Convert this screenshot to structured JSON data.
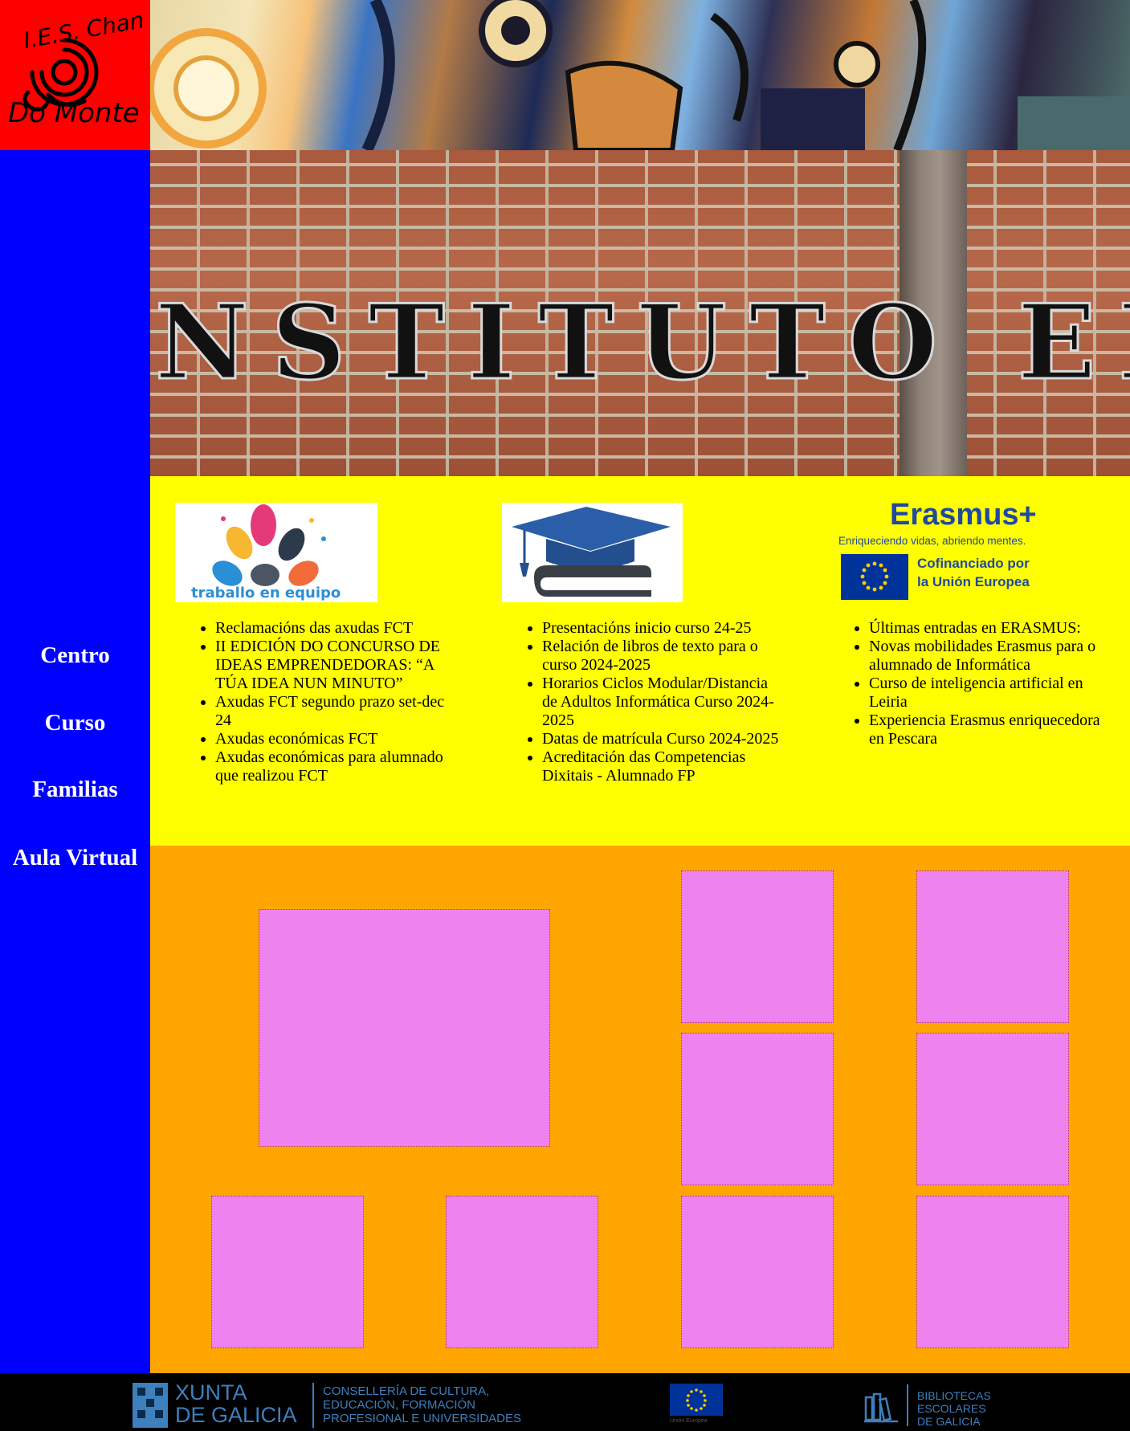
{
  "logo": {
    "line1": "I.E.S. Chan",
    "line2": "Do Monte"
  },
  "nav": [
    {
      "label": "Centro"
    },
    {
      "label": "Curso"
    },
    {
      "label": "Familias"
    },
    {
      "label": "Aula Virtual"
    }
  ],
  "hero": {
    "sign_text": "NSTITUTO",
    "sign_text_2": "EN"
  },
  "columns": [
    {
      "image_caption": "traballo en equipo",
      "items": [
        "Reclamacións das axudas FCT",
        "II EDICIÓN DO CONCURSO DE IDEAS EMPRENDEDORAS: “A TÚA IDEA NUN MINUTO”",
        "Axudas FCT segundo prazo set-dec 24",
        "Axudas económicas FCT",
        "Axudas económicas para alumnado que realizou FCT"
      ]
    },
    {
      "items": [
        "Presentacións inicio curso 24-25",
        "Relación de libros de texto para o curso 2024-2025",
        "Horarios Ciclos Modular/Distancia de Adultos Informática Curso 2024-2025",
        "Datas de matrícula Curso 2024-2025",
        "Acreditación das Competencias Dixitais - Alumnado FP"
      ]
    },
    {
      "erasmus_title": "Erasmus+",
      "erasmus_tagline": "Enriqueciendo vidas, abriendo mentes.",
      "erasmus_cofin_1": "Cofinanciado por",
      "erasmus_cofin_2": "la Unión Europea",
      "items": [
        "Últimas entradas en ERASMUS:",
        "Novas mobilidades Erasmus para o alumnado de Informática",
        "Curso de inteligencia artificial en Leiria",
        "Experiencia Erasmus enriquecedora en Pescara"
      ]
    }
  ],
  "footer": {
    "xunta_1": "XUNTA",
    "xunta_2": "DE GALICIA",
    "conselleria_1": "CONSELLERÍA DE CULTURA,",
    "conselleria_2": "EDUCACIÓN, FORMACIÓN",
    "conselleria_3": "PROFESIONAL E UNIVERSIDADES",
    "eu_small": "Unión Europea",
    "bib_1": "BIBLIOTECAS",
    "bib_2": "ESCOLARES",
    "bib_3": "DE GALICIA"
  },
  "colors": {
    "sidebar": "#0000ff",
    "logo_bg": "#ff0000",
    "news_bg": "#ffff00",
    "tiles_bg": "#ffa500",
    "tile": "#ee82ee",
    "footer": "#000000",
    "erasmus_blue": "#1f4aa0"
  }
}
